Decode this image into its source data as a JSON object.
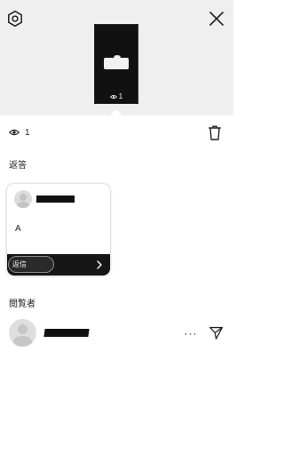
{
  "header": {
    "settings_icon": "gear-icon",
    "close_icon": "close-icon",
    "thumbnail": {
      "view_count": "1",
      "eye_icon": "eye-icon"
    }
  },
  "stats": {
    "view_count": "1",
    "eye_icon": "eye-icon",
    "delete_icon": "trash-icon"
  },
  "replies": {
    "section_label": "返答",
    "items": [
      {
        "message": "A",
        "reply_button_label": "返信",
        "chevron_icon": "chevron-right-icon"
      }
    ]
  },
  "viewers": {
    "section_label": "閲覧者",
    "items": [
      {
        "more_label": "···",
        "send_icon": "send-icon"
      }
    ]
  },
  "colors": {
    "header_background": "#efefef",
    "card_footer": "#161616",
    "text": "#222222"
  }
}
